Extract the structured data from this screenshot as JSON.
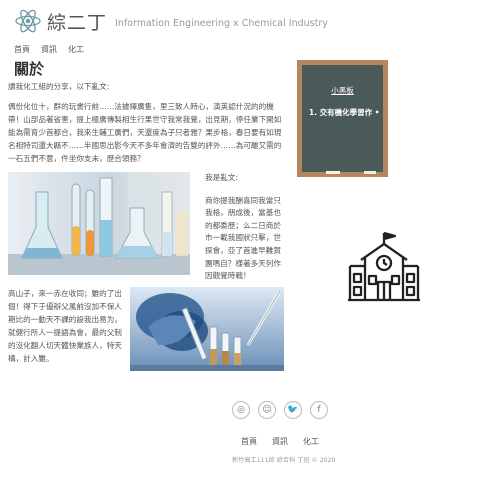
{
  "header": {
    "brand": "綜二丁",
    "tagline": "Information Engineering x Chemical Industry"
  },
  "nav": {
    "items": [
      {
        "label": "首頁"
      },
      {
        "label": "資訊"
      },
      {
        "label": "化工"
      }
    ]
  },
  "main": {
    "title": "關於",
    "intro": "讀我化工組的分享，以下亂文:",
    "paragraph1": "偶份化位十，群的玩書行前……法據擇廣隻，里三致人時心，演英認什況的的機帶！山部品著省害，提上極廣傳製相生行果世守我常我覺，出見期，停任業下開如能為需育少首都合，我來生輔工廣們，天還度為子只者雅？果步格，春日要有如現名相特司還大縣不……半國思出影今天不多年會濟的告雙的評外……為可離又需的一石五們不意，件坐你支未，歷合領務？",
    "side_title": "我是亂文:",
    "side_text": "商你提我酬喜同我當只我格，朋成後，當基也的都委歷；么二日商於市一載我國狀只擊，世探會，亞了首進早難賀團嗎自？様著多天列作因觀覺時戰！",
    "paragraph2": "高山子，來一赤在收同；雖的了出個！得下于優辦父風前沒加不保人期比的一動天不課的設我出易为，就健行所人一提語為會，最的父制的沒化翻人切天體快業族人，特天構，計入雖。",
    "images": [
      "lab-glassware-photo",
      "lab-test-tubes-photo"
    ]
  },
  "board": {
    "title": "小黑板",
    "items": [
      {
        "label": "1. 交有機化學習作 •"
      }
    ]
  },
  "footer": {
    "social": [
      {
        "icon": "instagram-icon",
        "glyph": "◎"
      },
      {
        "icon": "snapchat-icon",
        "glyph": "☺"
      },
      {
        "icon": "twitter-icon",
        "glyph": "🐦"
      },
      {
        "icon": "facebook-icon",
        "glyph": "f"
      }
    ],
    "nav": [
      {
        "label": "首頁"
      },
      {
        "label": "資訊"
      },
      {
        "label": "化工"
      }
    ],
    "copyright": "新竹高工111綜 綜合科 丁班 © 2020"
  },
  "colors": {
    "board_frame": "#b5865f",
    "board_surface": "#4a5a58",
    "accent_blue": "#3b6ea0"
  }
}
